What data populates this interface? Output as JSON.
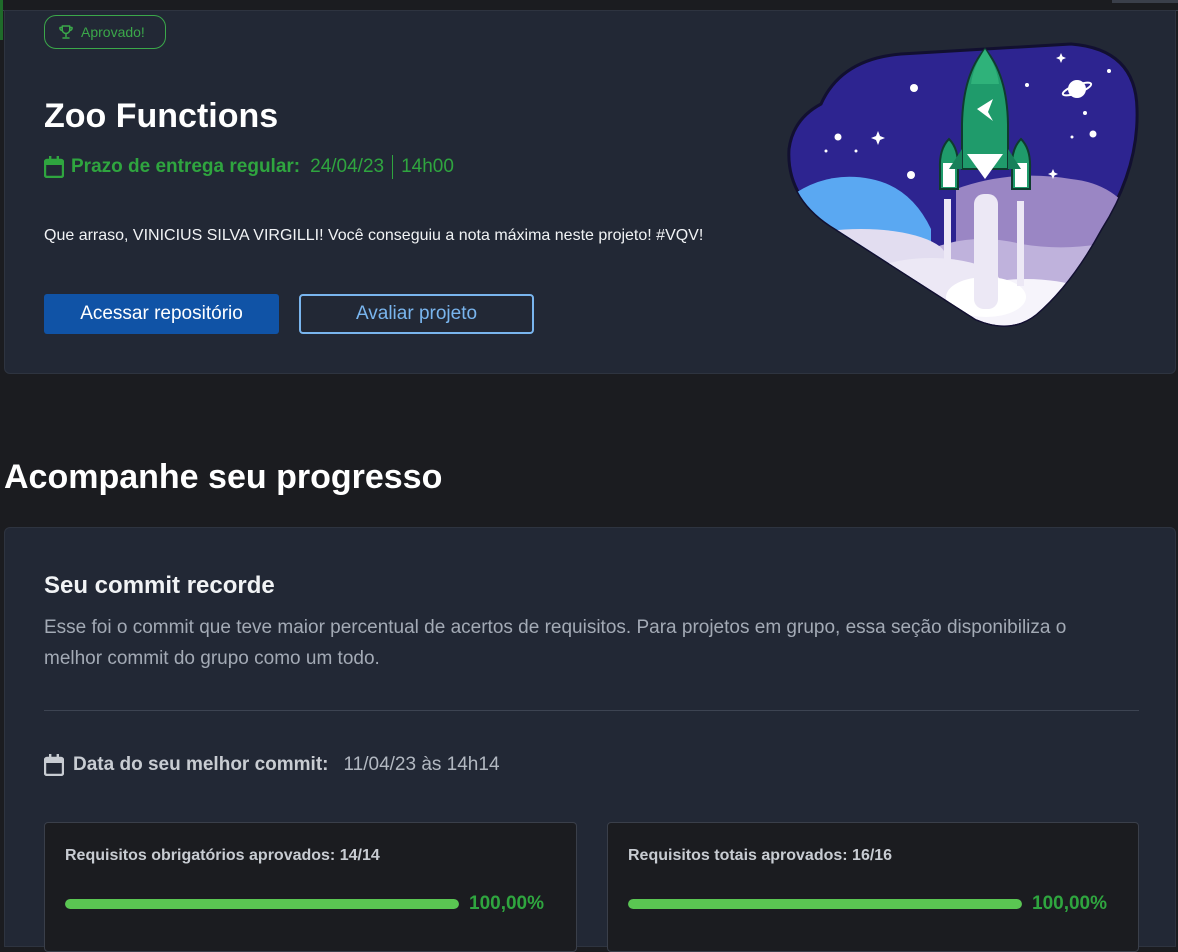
{
  "project": {
    "badge": "Aprovado!",
    "title": "Zoo Functions",
    "deadline_label": "Prazo de entrega regular:",
    "deadline_date": "24/04/23",
    "deadline_time": "14h00",
    "message": "Que arraso, VINICIUS SILVA VIRGILLI! Você conseguiu a nota máxima neste projeto! #VQV!",
    "btn_repo": "Acessar repositório",
    "btn_rate": "Avaliar projeto"
  },
  "progress": {
    "section_title": "Acompanhe seu progresso",
    "commit_title": "Seu commit recorde",
    "commit_desc": "Esse foi o commit que teve maior percentual de acertos de requisitos. Para projetos em grupo, essa seção disponibiliza o melhor commit do grupo como um todo.",
    "best_label": "Data do seu melhor commit:",
    "best_value": "11/04/23 às 14h14",
    "required": {
      "label": "Requisitos obrigatórios aprovados: 14/14",
      "percent_text": "100,00%",
      "fraction": 1.0
    },
    "total": {
      "label": "Requisitos totais aprovados: 16/16",
      "percent_text": "100,00%",
      "fraction": 1.0
    }
  },
  "icons": {
    "badge": "trophy-icon",
    "deadline": "calendar-icon",
    "best": "calendar-icon",
    "illustration": "rocket-illustration"
  },
  "colors": {
    "success": "#2fa53f",
    "primary": "#1053a6",
    "outline": "#79b5ee",
    "progress_fill": "#5ac652"
  }
}
